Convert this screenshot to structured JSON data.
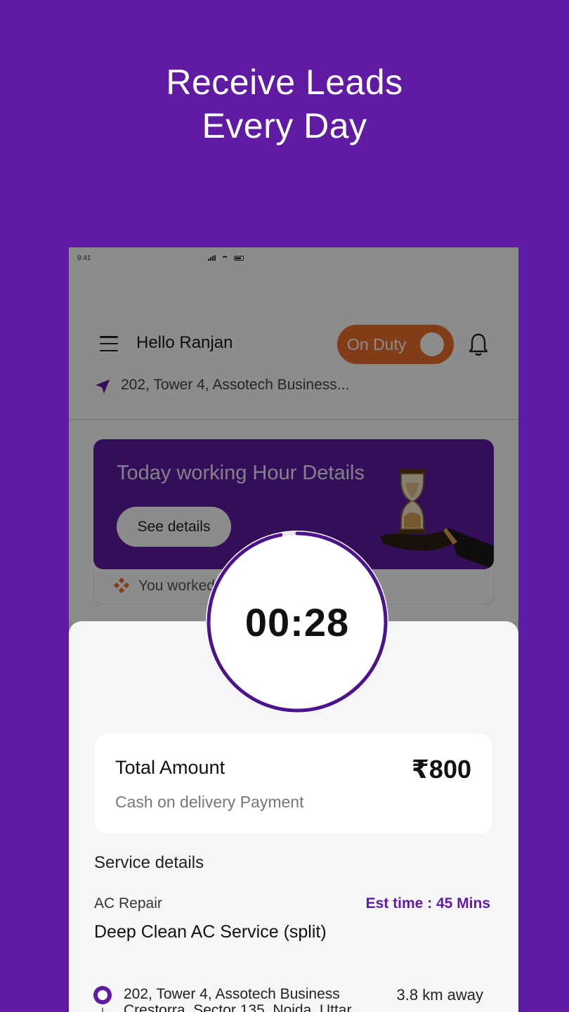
{
  "promo": {
    "headline_line1": "Receive Leads",
    "headline_line2": "Every Day"
  },
  "status_bar": {
    "time": "9:41"
  },
  "header": {
    "greeting": "Hello Ranjan",
    "duty_label": "On Duty",
    "duty_on": true,
    "duty_color": "#e96f2a"
  },
  "location": {
    "text": "202, Tower 4, Assotech Business..."
  },
  "working_hours": {
    "title": "Today working Hour Details",
    "button": "See details",
    "worked_text": "You worked"
  },
  "timer": {
    "value": "00:28",
    "progress": 0.97
  },
  "total": {
    "label": "Total Amount",
    "amount": "₹800",
    "payment": "Cash on delivery Payment"
  },
  "service": {
    "heading": "Service details",
    "category": "AC Repair",
    "est_time": "Est time : 45 Mins",
    "name": "Deep Clean AC Service (split)",
    "address_line1": "202, Tower 4, Assotech Business",
    "address_line2": "Crestorra, Sector 135, Noida, Uttar",
    "distance": "3.8 km away"
  },
  "colors": {
    "brand": "#5f1ca3",
    "accent": "#e96f2a"
  }
}
